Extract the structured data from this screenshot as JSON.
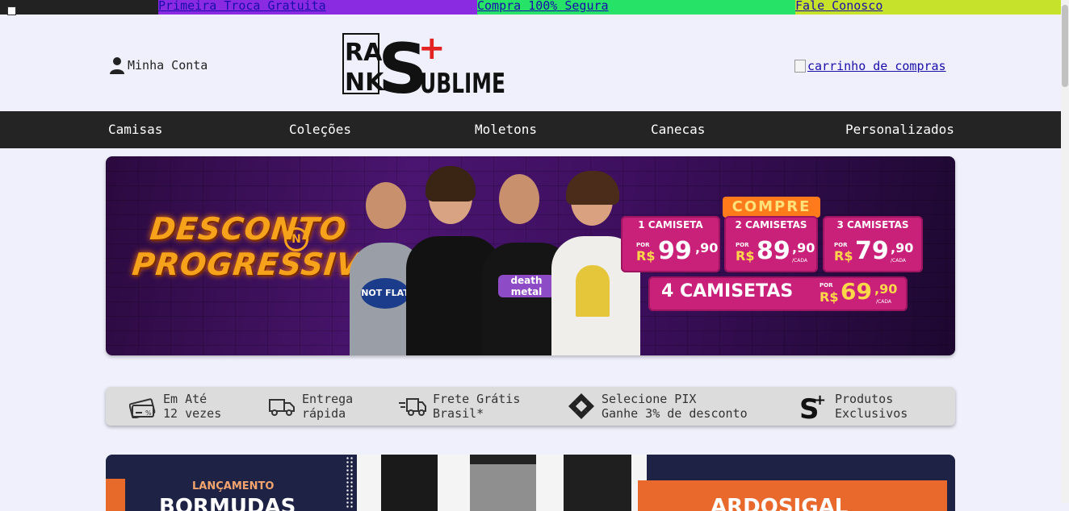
{
  "topbar": {
    "links": [
      {
        "label": "Primeira Troca Gratuita",
        "bg": "#8a2be2"
      },
      {
        "label": "Compra 100% Segura",
        "bg": "#26e368"
      },
      {
        "label": "Fale Conosco",
        "bg": "#c6e22b"
      }
    ],
    "left_bg": "#222222"
  },
  "header": {
    "account_label": "Minha Conta",
    "account_icon": "user-icon",
    "logo_letters_left": [
      "RA",
      "NK"
    ],
    "logo_big": "S",
    "logo_word": "UBLIME",
    "logo_plus": "+",
    "cart_alt": "carrinho de compras"
  },
  "nav": {
    "items": [
      "Camisas",
      "Coleções",
      "Moletons",
      "Canecas",
      "Personalizados"
    ]
  },
  "banner": {
    "title_line1": "DESCONTO",
    "title_line2": "PROGRESSIVO",
    "badge": "N",
    "compre": "COMPRE",
    "offers": [
      {
        "title": "1 CAMISETA",
        "por": "POR",
        "rs": "R$",
        "price": "99",
        "cents": ",90",
        "cada": ""
      },
      {
        "title": "2 CAMISETAS",
        "por": "POR",
        "rs": "R$",
        "price": "89",
        "cents": ",90",
        "cada": "/CADA"
      },
      {
        "title": "3 CAMISETAS",
        "por": "POR",
        "rs": "R$",
        "price": "79",
        "cents": ",90",
        "cada": "/CADA"
      },
      {
        "title": "4 CAMISETAS",
        "por": "POR",
        "rs": "R$",
        "price": "69",
        "cents": ",90",
        "cada": "/CADA"
      }
    ],
    "shirt_texts": [
      "NOT FLAT",
      "death metal"
    ]
  },
  "features": [
    {
      "icon": "credit-card-icon",
      "line1": "Em Até",
      "line2": "12 vezes"
    },
    {
      "icon": "truck-icon",
      "line1": "Entrega",
      "line2": "rápida"
    },
    {
      "icon": "fast-truck-icon",
      "line1": "Frete Grátis",
      "line2": "Brasil*"
    },
    {
      "icon": "pix-icon",
      "line1": "Selecione PIX",
      "line2": "Ganhe 3% de desconto"
    },
    {
      "icon": "brand-s-plus-icon",
      "line1": "Produtos",
      "line2": "Exclusivos"
    }
  ],
  "banner2": {
    "tag": "LANÇAMENTO",
    "title_left": "BORMUDAS",
    "title_right": "ARDOSIGAL"
  },
  "colors": {
    "nav_bg": "#242424",
    "page_bg": "#eff0fb",
    "banner_orange": "#f7a21b",
    "offer_pink": "#c9207a"
  }
}
